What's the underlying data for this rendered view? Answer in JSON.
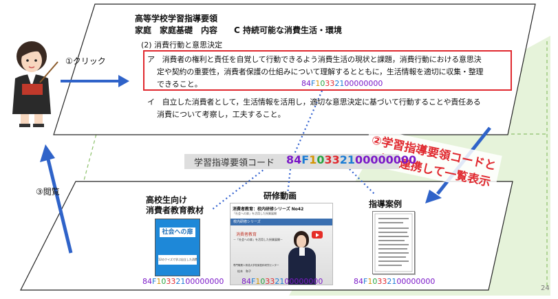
{
  "guideline": {
    "title": "高等学校学習指導要領",
    "subject_line": "家庭　家庭基礎　内容　　C 持続可能な消費生活・環境",
    "section": "(2) 消費行動と意思決定",
    "item_a_line1": "ア　消費者の権利と責任を自覚して行動できるよう消費生活の現状と課題，消費行動における意思決",
    "item_a_line2": "定や契約の重要性，消費者保護の仕組みについて理解するとともに，生活情報を適切に収集・整理",
    "item_a_line3": "できること。",
    "item_i_line1": "イ　自立した消費者として，生活情報を活用し，適切な意思決定に基づいて行動することや責任ある",
    "item_i_line2": "消費について考察し，工夫すること。"
  },
  "steps": {
    "click": "①クリック",
    "view": "③閲覧",
    "auto_line1": "②学習指導要領コードと",
    "auto_line2": "自動連携して一覧表示"
  },
  "code_banner_label": "学習指導要領コード",
  "code_parts": [
    "84",
    "F",
    "1",
    "0",
    "3",
    "3",
    "2",
    "1",
    "0",
    "0",
    "0",
    "0",
    "0",
    "0",
    "0",
    "0"
  ],
  "code_colors": [
    "#7a18c8",
    "#1b7bd4",
    "#d49400",
    "#27a33f",
    "#e0282e",
    "#e0282e",
    "#1b7bd4",
    "#1b7bd4",
    "#7a18c8",
    "#7a18c8",
    "#7a18c8",
    "#7a18c8",
    "#7a18c8",
    "#7a18c8",
    "#7a18c8",
    "#7a18c8"
  ],
  "categories": {
    "material_line1": "高校生向け",
    "material_line2": "消費者教育教材",
    "video": "研修動画",
    "cases": "指導案例"
  },
  "video_thumb": {
    "title": "消費者教育：校内研修シリーズ No42",
    "subtitle": "「社会への扉」を活用した授業展開",
    "series": "校内研修シリーズ",
    "main1": "消費者教育",
    "main2": "－「社会への扉」を活用した授業展開－",
    "org": "専門職業人育成大学校家庭科研究センター",
    "speaker": "松本　和子"
  },
  "material_thumb": {
    "cover_title": "社会への扉",
    "cover_sub": "12のクイズで学ぶ自立した消費者"
  },
  "page_number": "24"
}
